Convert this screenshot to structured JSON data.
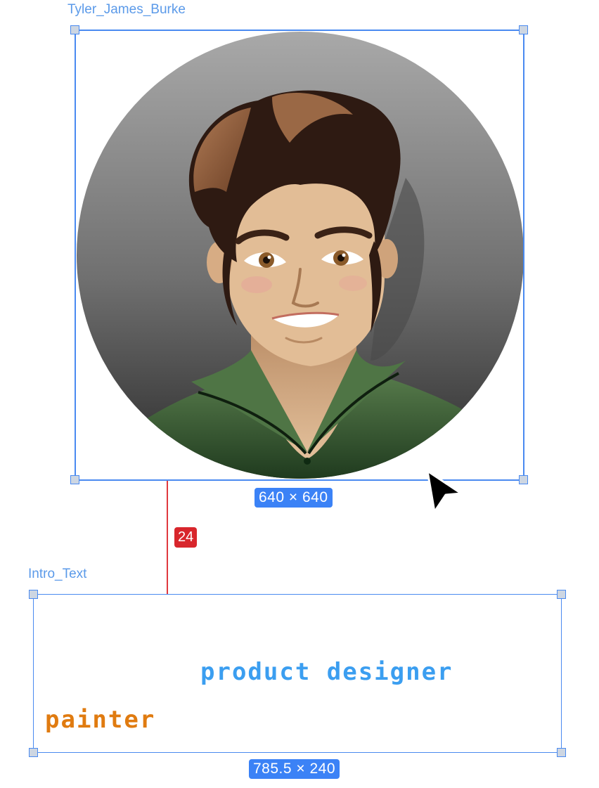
{
  "canvas": {
    "avatar_frame": {
      "name": "Tyler_James_Burke",
      "dimensions": "640 × 640"
    },
    "spacing": {
      "value": "24"
    },
    "intro_frame": {
      "name": "Intro_Text",
      "dimensions": "785.5 × 240",
      "texts": [
        {
          "text": "product designer",
          "color": "#3b9ef0"
        },
        {
          "text": "painter",
          "color": "#e07b10"
        }
      ]
    }
  },
  "colors": {
    "selection": "#4a8af0",
    "spacing": "#d8262c"
  },
  "icons": [
    "pointer-cursor-icon"
  ]
}
